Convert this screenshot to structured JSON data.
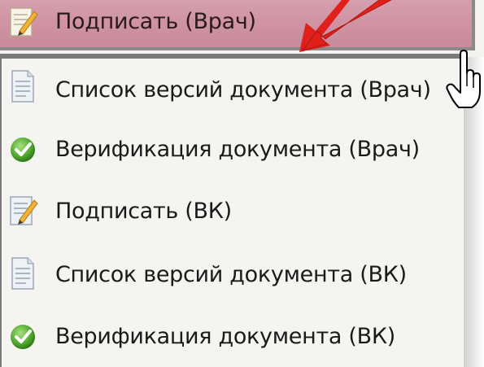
{
  "menu": {
    "active_item": {
      "label": "Подписать (Врач)",
      "icon": "sign-document-icon"
    },
    "items": [
      {
        "label": "Список версий документа (Врач)",
        "icon": "document-list-icon"
      },
      {
        "label": "Верификация документа (Врач)",
        "icon": "green-check-icon"
      },
      {
        "label": "Подписать (ВК)",
        "icon": "sign-document-icon"
      },
      {
        "label": "Список версий документа (ВК)",
        "icon": "document-list-icon"
      },
      {
        "label": "Верификация документа (ВК)",
        "icon": "green-check-icon"
      }
    ]
  },
  "colors": {
    "highlight": "#cf93a3",
    "arrow": "#e0201a",
    "check": "#5bb43a"
  }
}
